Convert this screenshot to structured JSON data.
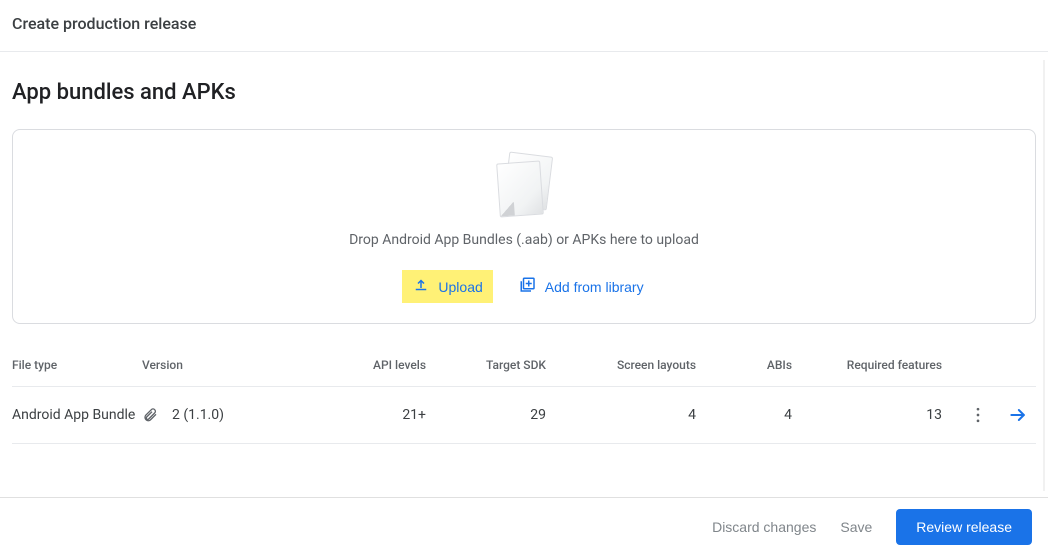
{
  "header": {
    "title": "Create production release"
  },
  "section": {
    "title": "App bundles and APKs",
    "drop_text": "Drop Android App Bundles (.aab) or APKs here to upload",
    "upload_label": "Upload",
    "add_from_library_label": "Add from library"
  },
  "table": {
    "columns": {
      "file_type": "File type",
      "version": "Version",
      "api_levels": "API levels",
      "target_sdk": "Target SDK",
      "screen_layouts": "Screen layouts",
      "abis": "ABIs",
      "required_features": "Required features"
    },
    "rows": [
      {
        "file_type": "Android App Bundle",
        "version": "2 (1.1.0)",
        "api_levels": "21+",
        "target_sdk": "29",
        "screen_layouts": "4",
        "abis": "4",
        "required_features": "13"
      }
    ]
  },
  "footer": {
    "discard": "Discard changes",
    "save": "Save",
    "review": "Review release"
  }
}
